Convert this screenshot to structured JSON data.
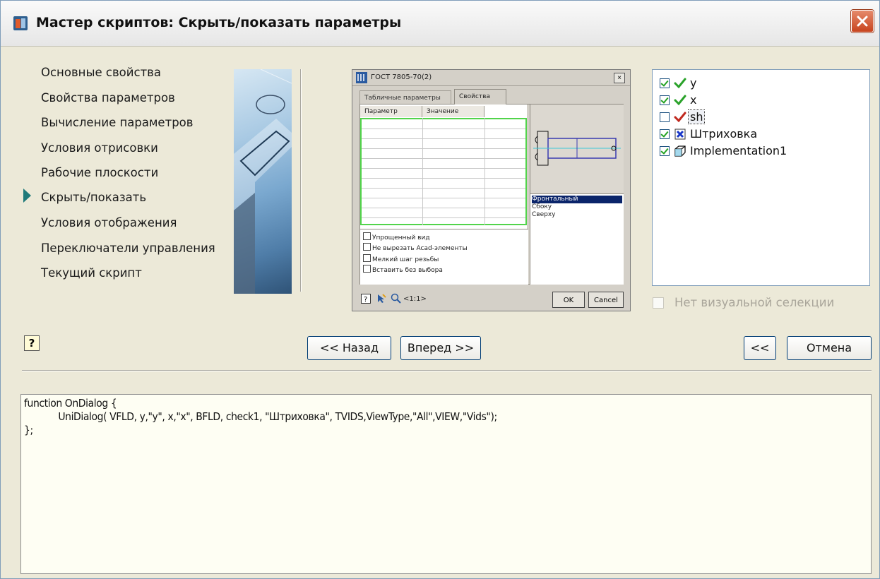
{
  "window": {
    "title": "Мастер скриптов:  Скрыть/показать параметры"
  },
  "nav": {
    "items": [
      "Основные свойства",
      "Свойства параметров",
      "Вычисление параметров",
      "Условия отрисовки",
      "Рабочие плоскости",
      "Скрыть/показать",
      "Условия отображения",
      "Переключатели управления",
      "Текущий скрипт"
    ],
    "active_index": 5
  },
  "preview": {
    "title": "ГОСТ 7805-70(2)",
    "tabs": [
      "Табличные параметры",
      "Свойства"
    ],
    "grid_headers": [
      "Параметр",
      "Значение"
    ],
    "views": [
      "Фронтальный",
      "Сбоку",
      "Сверху"
    ],
    "selected_view": "Фронтальный",
    "checkboxes": [
      "Упрощенный вид",
      "Не вырезать Acad-элементы",
      "Мелкий шаг резьбы",
      "Вставить без выбора"
    ],
    "zoom": "<1:1>",
    "ok": "OK",
    "cancel": "Cancel",
    "close": "×"
  },
  "tree": {
    "items": [
      {
        "label": "y",
        "checked": true,
        "icon": "green-check-icon"
      },
      {
        "label": "x",
        "checked": true,
        "icon": "green-check-icon"
      },
      {
        "label": "sh",
        "checked": false,
        "icon": "red-check-icon"
      },
      {
        "label": "Штриховка",
        "checked": true,
        "icon": "blue-x-icon"
      },
      {
        "label": "Implementation1",
        "checked": true,
        "icon": "cube-icon"
      }
    ]
  },
  "no_visual_selection": {
    "label": "Нет визуальной селекции",
    "checked": false,
    "enabled": false
  },
  "buttons": {
    "help": "?",
    "back": "<< Назад",
    "next": "Вперед >>",
    "collapse": "<<",
    "cancel": "Отмена"
  },
  "code": {
    "lines": [
      "function OnDialog {",
      "            UniDialog( VFLD, y,\"y\", x,\"x\", BFLD, check1, \"Штриховка\", TVIDS,ViewType,\"All\",VIEW,\"Vids\");",
      "};"
    ]
  },
  "colors": {
    "accent_arrow": "#1f7a7a",
    "code_bg": "#fefef3",
    "selection": "#0a246a"
  }
}
